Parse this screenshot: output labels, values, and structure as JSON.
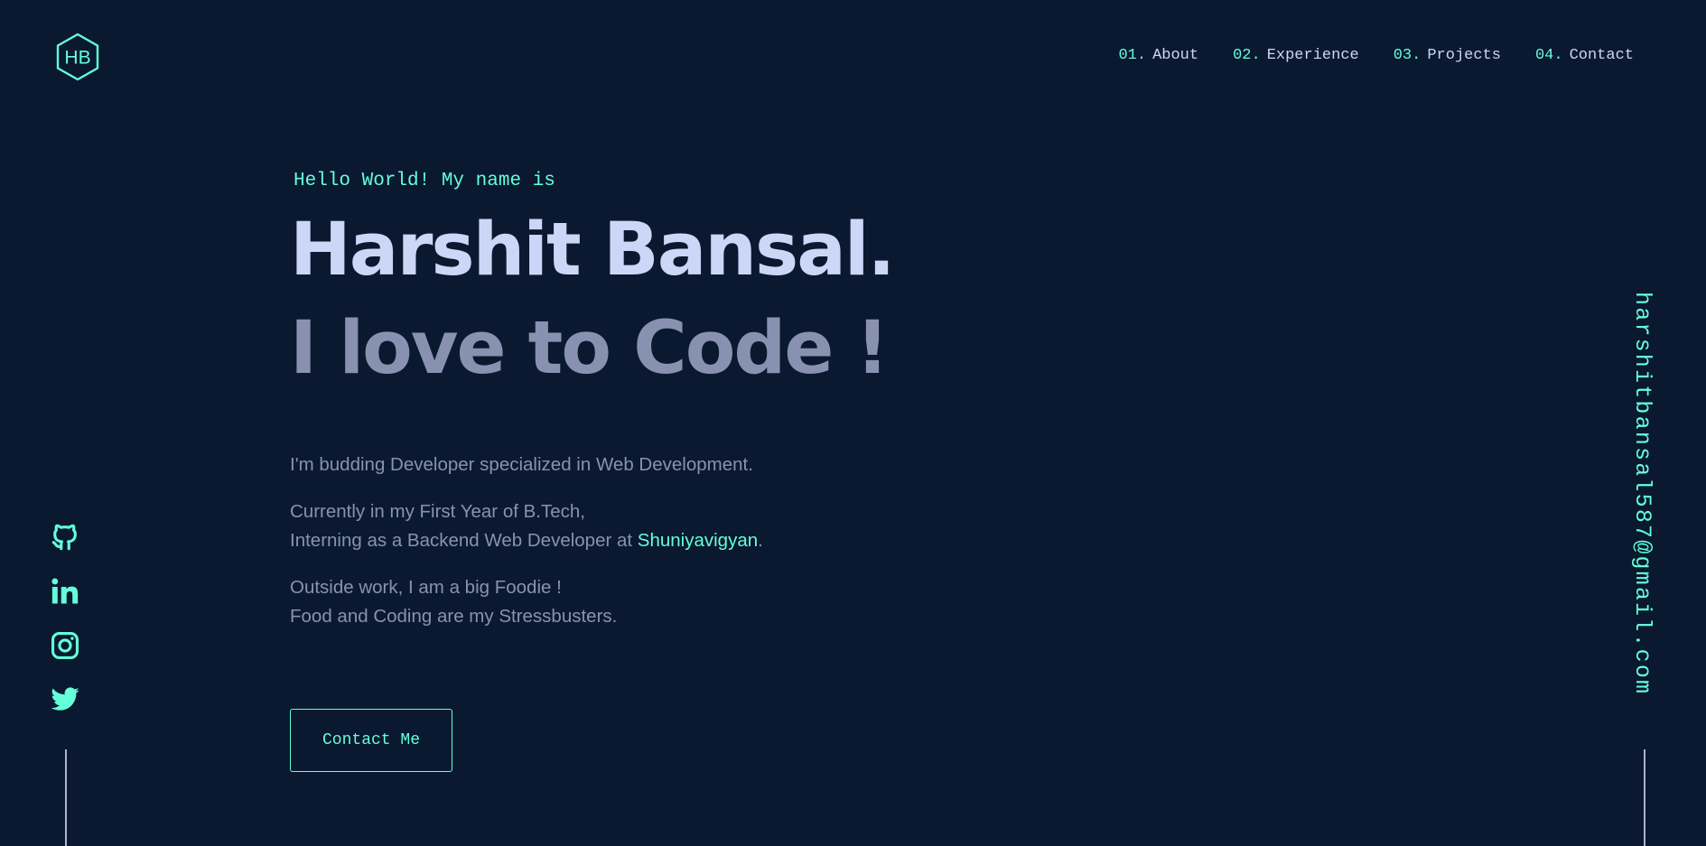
{
  "logo": {
    "initials": "HB"
  },
  "nav": [
    {
      "num": "01.",
      "label": "About"
    },
    {
      "num": "02.",
      "label": "Experience"
    },
    {
      "num": "03.",
      "label": "Projects"
    },
    {
      "num": "04.",
      "label": "Contact"
    }
  ],
  "hero": {
    "greeting": "Hello World! My name is",
    "name": "Harshit Bansal.",
    "tagline": "I love to Code !",
    "bio": {
      "line1": "I'm budding Developer specialized in Web Development.",
      "line2": "Currently in my First Year of B.Tech,",
      "line3_prefix": "Interning as a Backend Web Developer at ",
      "company": "Shuniyavigyan",
      "line3_suffix": ".",
      "line4": "Outside work, I am a big Foodie !",
      "line5": "Food and Coding are my Stressbusters."
    },
    "cta": "Contact Me"
  },
  "social": [
    "github-icon",
    "linkedin-icon",
    "instagram-icon",
    "twitter-icon"
  ],
  "email": "harshitbansal587@gmail.com",
  "colors": {
    "background": "#0a192f",
    "accent": "#64ffda",
    "heading": "#ccd6f6",
    "text": "#8892b0"
  }
}
